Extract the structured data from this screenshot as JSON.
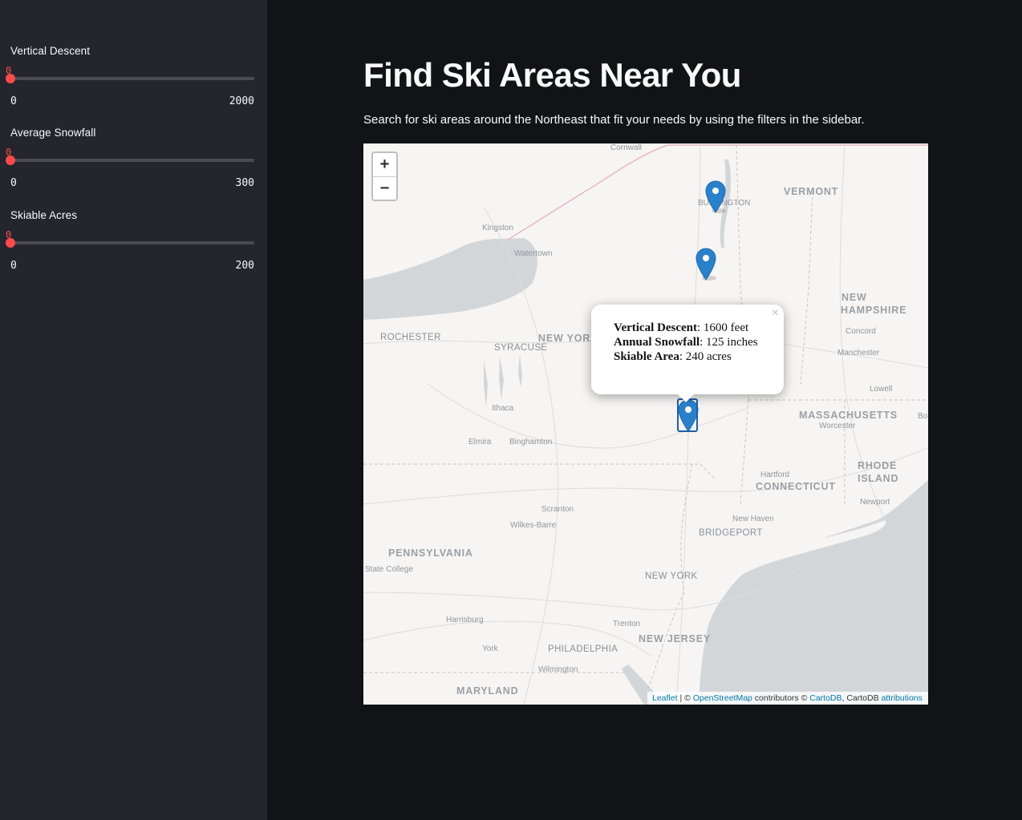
{
  "sidebar": {
    "sliders": [
      {
        "label": "Vertical Descent",
        "value": "0",
        "min": "0",
        "max": "2000"
      },
      {
        "label": "Average Snowfall",
        "value": "0",
        "min": "0",
        "max": "300"
      },
      {
        "label": "Skiable Acres",
        "value": "0",
        "min": "0",
        "max": "200"
      }
    ]
  },
  "main": {
    "title": "Find Ski Areas Near You",
    "description": "Search for ski areas around the Northeast that fit your needs by using the filters in the sidebar."
  },
  "map": {
    "zoom_in": "+",
    "zoom_out": "−",
    "labels": {
      "vermont": "VERMONT",
      "new_hampshire_1": "NEW",
      "new_hampshire_2": "HAMPSHIRE",
      "new_york_state": "NEW YORK",
      "massachusetts": "MASSACHUSETTS",
      "rhode_island_1": "RHODE",
      "rhode_island_2": "ISLAND",
      "connecticut": "CONNECTICUT",
      "pennsylvania": "PENNSYLVANIA",
      "new_jersey": "NEW JERSEY",
      "maryland": "MARYLAND",
      "cornwall": "Cornwall",
      "burlington": "BURLINGTON",
      "kingston": "Kingston",
      "watertown": "Watertown",
      "rochester": "ROCHESTER",
      "syracuse": "SYRACUSE",
      "concord": "Concord",
      "manchester": "Manchester",
      "lowell": "Lowell",
      "worcester": "Worcester",
      "ithaca": "Ithaca",
      "elmira": "Elmira",
      "binghamton": "Binghamton",
      "hartford": "Hartford",
      "newport": "Newport",
      "scranton": "Scranton",
      "wilkes_barre": "Wilkes-Barre",
      "new_haven": "New Haven",
      "bridgeport": "BRIDGEPORT",
      "state_college": "State College",
      "new_york_city": "NEW YORK",
      "harrisburg": "Harrisburg",
      "trenton": "Trenton",
      "york": "York",
      "philadelphia": "PHILADELPHIA",
      "wilmington": "Wilmington",
      "bo": "Bo"
    },
    "popup": {
      "close": "×",
      "vertical_label": "Vertical Descent",
      "vertical_value": ": 1600 feet",
      "snowfall_label": "Annual Snowfall",
      "snowfall_value": ": 125 inches",
      "area_label": "Skiable Area",
      "area_value": ": 240 acres"
    },
    "attribution": {
      "leaflet": "Leaflet",
      "sep1": " | © ",
      "osm": "OpenStreetMap",
      "contrib": " contributors © ",
      "cartodb": "CartoDB",
      "sep2": ", CartoDB ",
      "attribution": "attributions"
    },
    "marker_color": "#2a81cb"
  }
}
